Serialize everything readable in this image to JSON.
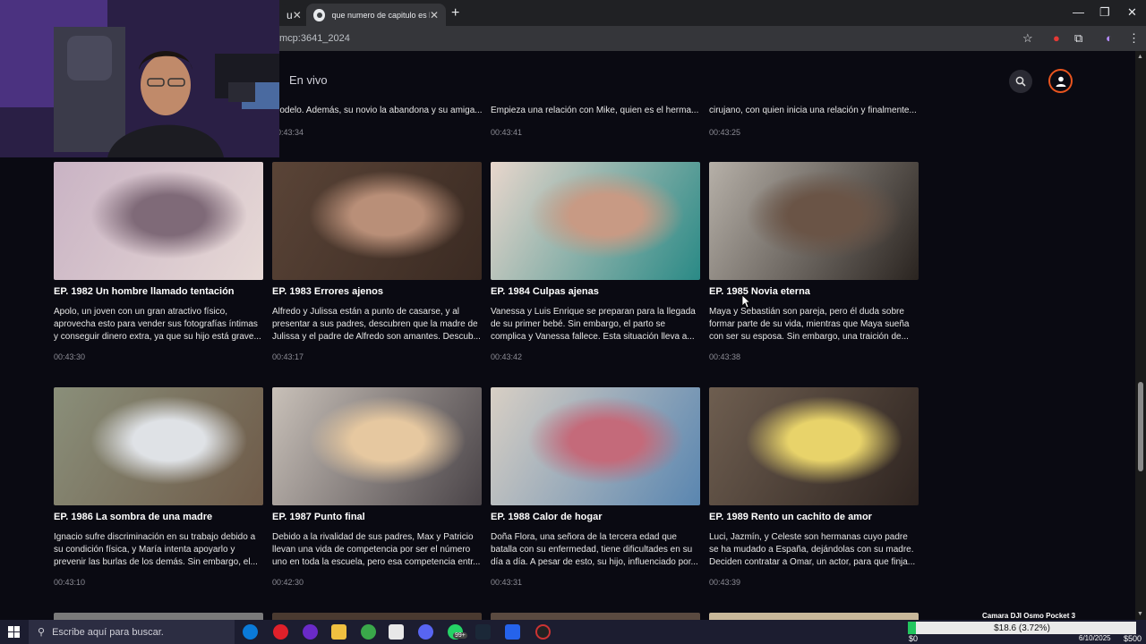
{
  "browser": {
    "tabs": [
      {
        "label": "u",
        "active": false
      },
      {
        "label": "que numero de capitulo es la s",
        "active": true
      }
    ],
    "url": "mcp:3641_2024"
  },
  "site": {
    "nav_live": "En vivo"
  },
  "previous_row": [
    {
      "desc": "modelo. Además, su novio la abandona y su amiga...",
      "duration": "00:43:34"
    },
    {
      "desc": "Empieza una relación con Mike, quien es el herma...",
      "duration": "00:43:41"
    },
    {
      "desc": "cirujano, con quien inicia una relación y finalmente...",
      "duration": "00:43:25"
    }
  ],
  "episodes": [
    {
      "title": "EP. 1982  Un hombre llamado tentación",
      "desc": "Apolo, un joven con un gran atractivo físico, aprovecha esto para vender sus fotografías íntimas y conseguir dinero extra, ya que su hijo está grave...",
      "duration": "00:43:30",
      "colors": [
        "#c9b3c4",
        "#7f6a78",
        "#e7d9d6"
      ]
    },
    {
      "title": "EP. 1983  Errores ajenos",
      "desc": "Alfredo y Julissa están a punto de casarse, y al presentar a sus padres, descubren que la madre de Julissa y el padre de Alfredo son amantes. Descub...",
      "duration": "00:43:17",
      "colors": [
        "#5a4437",
        "#b98f78",
        "#3a2a22"
      ]
    },
    {
      "title": "EP. 1984  Culpas ajenas",
      "desc": "Vanessa y Luis Enrique se preparan para la llegada de su primer bebé. Sin embargo, el parto se complica y Vanessa fallece. Esta situación lleva a...",
      "duration": "00:43:42",
      "colors": [
        "#e8d6cc",
        "#c89a84",
        "#2a8a86"
      ]
    },
    {
      "title": "EP. 1985  Novia eterna",
      "desc": "Maya y Sebastián son pareja, pero él duda sobre formar parte de su vida, mientras que Maya sueña con ser su esposa. Sin embargo, una traición de...",
      "duration": "00:43:38",
      "colors": [
        "#b6b0a8",
        "#6a5446",
        "#2a2420"
      ]
    },
    {
      "title": "EP. 1986  La sombra de una madre",
      "desc": "Ignacio sufre discriminación en su trabajo debido a su condición física, y María intenta apoyarlo y prevenir las burlas de los demás. Sin embargo, el...",
      "duration": "00:43:10",
      "colors": [
        "#8a8f7a",
        "#dfe2e6",
        "#6e5a48"
      ]
    },
    {
      "title": "EP. 1987  Punto final",
      "desc": "Debido a la rivalidad de sus padres, Max y Patricio llevan una vida de competencia por ser el número uno en toda la escuela, pero esa competencia entr...",
      "duration": "00:42:30",
      "colors": [
        "#c8c0b8",
        "#e6c8a0",
        "#4a4448"
      ]
    },
    {
      "title": "EP. 1988  Calor de hogar",
      "desc": "Doña Flora, una señora de la tercera edad que batalla con su enfermedad, tiene dificultades en su día a día. A pesar de esto, su hijo, influenciado por...",
      "duration": "00:43:31",
      "colors": [
        "#d8cfc4",
        "#c46a7a",
        "#5a86b0"
      ]
    },
    {
      "title": "EP. 1989  Rento un cachito de amor",
      "desc": "Luci, Jazmín, y Celeste son hermanas cuyo padre se ha mudado a España, dejándolas con su madre. Deciden contratar a Omar, un actor, para que finja...",
      "duration": "00:43:39",
      "colors": [
        "#6e5e50",
        "#e8d36a",
        "#2e2420"
      ]
    }
  ],
  "taskbar": {
    "search_placeholder": "Escribe aquí para buscar.",
    "camera_label": "Camara DJI Osmo Pocket 3",
    "price_text": "$18.6 (3.72%)",
    "price_fraction": 0.0372,
    "balance_left": "$0",
    "balance_right": "$500",
    "date": "6/10/2025",
    "whatsapp_badge": "99+"
  }
}
